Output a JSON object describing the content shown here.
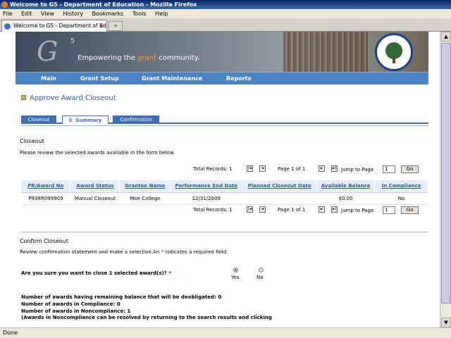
{
  "window": {
    "title": "Welcome to G5 - Department of Education - Mozilla Firefox",
    "status": "Done"
  },
  "menu": [
    "File",
    "Edit",
    "View",
    "History",
    "Bookmarks",
    "Tools",
    "Help"
  ],
  "browser_tab": {
    "label": "Welcome to G5 - Department of Educ...",
    "close": "×",
    "new_tab": "+"
  },
  "banner": {
    "logo_g": "G",
    "logo_five": "5",
    "tagline_pre": "Empowering the ",
    "tagline_highlight": "grant",
    "tagline_post": " community."
  },
  "nav": [
    "Main",
    "Grant Setup",
    "Grant Maintenance",
    "Reports"
  ],
  "page_title": "Approve Award Closeout",
  "workflow_tabs": [
    "Closeout",
    "Summary",
    "Confirmation"
  ],
  "closeout": {
    "heading": "Closeout",
    "description": "Please review the selected awards available in the form below."
  },
  "pager": {
    "total_records": "Total Records: 1",
    "page_label": "Page 1 of 1",
    "jump_label": "Jump to Page",
    "jump_value": "1",
    "go_label": "Go",
    "first": "|◄",
    "prev": "◄",
    "next": "►",
    "last": "►|"
  },
  "table": {
    "headers": [
      "PR/Award No",
      "Award Status",
      "Grantee Name",
      "Performance End Date",
      "Planned Closeout Date",
      "Available Balance",
      "In Compliance"
    ],
    "rows": [
      [
        "P938R099909",
        "Manual Closeout",
        "Moe College",
        "12/31/2009",
        "",
        "$0.00",
        "No"
      ]
    ]
  },
  "confirm": {
    "heading": "Confirm Closeout",
    "description_pre": "Review confirmation statement and make a selection.An ",
    "required_mark": "*",
    "description_post": " indicates a required field.",
    "question": "Are you sure you want to close 1 selected award(s)?",
    "options": [
      "Yes",
      "No"
    ],
    "selected": "Yes"
  },
  "summary_lines": [
    "Number of awards having remaining balance that will be deobligated: 0",
    "Number of awards in Compliance: 0",
    "Number of awards in Noncompliance: 1",
    "(Awards in Noncompliance can be resolved by returning to the search results and clicking"
  ],
  "colors": {
    "nav_blue": "#4d84c4",
    "title_blue": "#3560a0",
    "header_bg": "#e5edf8",
    "required_red": "#cc0000"
  }
}
